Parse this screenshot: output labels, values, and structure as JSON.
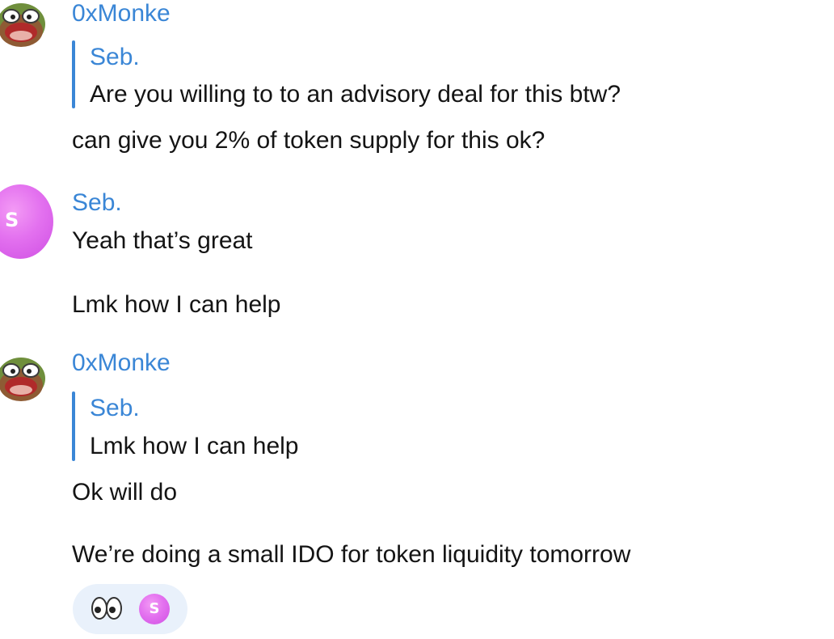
{
  "messages": [
    {
      "sender": "0xMonke",
      "reply": {
        "name": "Seb.",
        "text": "Are you willing to to an advisory deal for this btw?"
      },
      "lines": [
        "can give you 2% of token supply for this ok?"
      ]
    },
    {
      "sender": "Seb.",
      "avatar_letter": "S",
      "lines": [
        "Yeah that’s great",
        "Lmk how I can help"
      ]
    },
    {
      "sender": "0xMonke",
      "reply": {
        "name": "Seb.",
        "text": "Lmk how I can help"
      },
      "lines": [
        "Ok will do",
        "We’re doing a small IDO for token liquidity tomorrow"
      ],
      "reaction": {
        "emoji": "eyes",
        "avatar_letter": "S"
      }
    }
  ],
  "colors": {
    "sender_blue": "#3a86d6",
    "text": "#141414",
    "reaction_bg": "#e9f1fb",
    "avatar_pink": "#e371ef"
  },
  "icons": {
    "pepe_avatar": "pepe-frog-avatar-icon",
    "eyes": "eyes-emoji-icon"
  }
}
